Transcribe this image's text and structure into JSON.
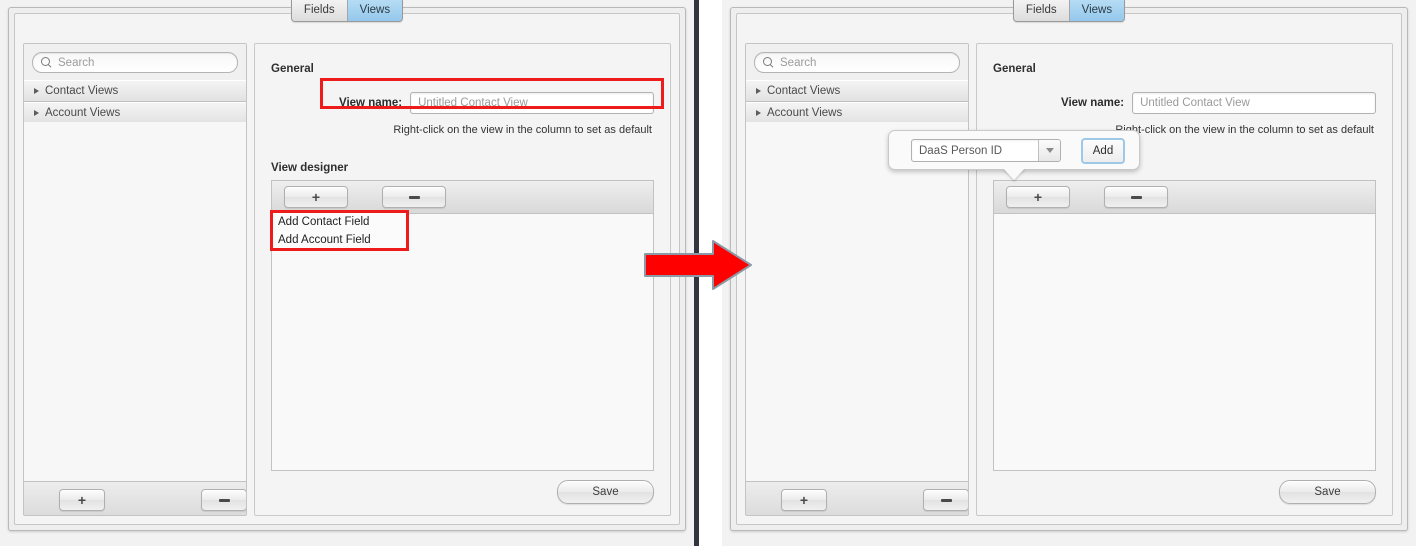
{
  "app": {
    "tabs": [
      {
        "label": "Fields",
        "selected": false
      },
      {
        "label": "Views",
        "selected": true
      }
    ]
  },
  "sidebar": {
    "search_placeholder": "Search",
    "groups": [
      {
        "label": "Contact Views"
      },
      {
        "label": "Account Views"
      }
    ],
    "add_label": "+",
    "remove_label": "–"
  },
  "content": {
    "general_title": "General",
    "view_name_label": "View name:",
    "view_name_value": "Untitled Contact View",
    "hint": "Right-click on the view in the column to set as default",
    "designer_title": "View designer",
    "designer_add": "+",
    "designer_remove": "–",
    "save_label": "Save"
  },
  "context_menu": {
    "items": [
      {
        "label": "Add Contact Field"
      },
      {
        "label": "Add Account Field"
      }
    ]
  },
  "popover": {
    "dropdown_value": "DaaS Person ID",
    "add_button_label": "Add"
  },
  "colors": {
    "highlight": "#ee1b1b",
    "arrow": "#fe0000",
    "tab_selected": "#94c8ec",
    "focus_ring": "#9ec8e8"
  }
}
